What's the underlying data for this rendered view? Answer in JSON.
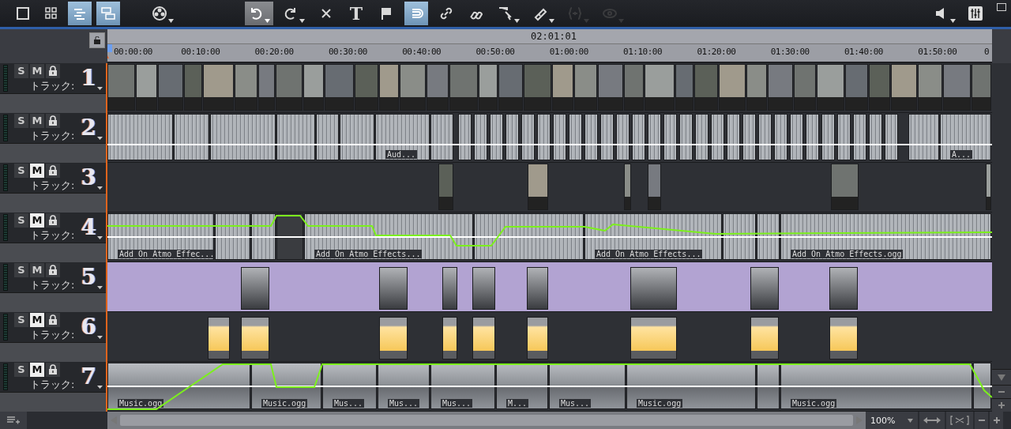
{
  "toolbar": {
    "groups": [
      [
        {
          "kind": "single-view",
          "selected": false,
          "disabled": false
        },
        {
          "kind": "grid-view",
          "selected": false,
          "disabled": false
        },
        {
          "kind": "timeline-view",
          "selected": true,
          "disabled": false
        },
        {
          "kind": "clip-view",
          "selected": true,
          "disabled": false
        }
      ],
      [
        {
          "kind": "reel",
          "selected": false,
          "disabled": false,
          "dropdown": true
        }
      ],
      [
        {
          "kind": "undo",
          "selected": true,
          "disabled": false,
          "dropdown": true
        },
        {
          "kind": "redo",
          "selected": false,
          "disabled": false,
          "dropdown": true
        },
        {
          "kind": "delete",
          "selected": false,
          "disabled": false
        },
        {
          "kind": "text",
          "text": "T",
          "selected": false,
          "disabled": false
        },
        {
          "kind": "flag",
          "selected": false,
          "disabled": false
        },
        {
          "kind": "magnet",
          "selected": true,
          "disabled": false
        },
        {
          "kind": "link",
          "selected": false,
          "disabled": false
        },
        {
          "kind": "unlink",
          "selected": false,
          "disabled": false
        },
        {
          "kind": "pointer",
          "selected": false,
          "disabled": false,
          "dropdown": true
        },
        {
          "kind": "razor",
          "selected": false,
          "disabled": false,
          "dropdown": true
        },
        {
          "kind": "effect",
          "selected": false,
          "disabled": true,
          "dropdown": true
        },
        {
          "kind": "eye",
          "selected": false,
          "disabled": true,
          "dropdown": true
        }
      ]
    ],
    "right": [
      {
        "kind": "speaker",
        "selected": false,
        "disabled": false,
        "dropdown": true
      },
      {
        "kind": "mixer",
        "selected": false,
        "disabled": false
      }
    ]
  },
  "ruler": {
    "duration": "02:01:01",
    "ticks": [
      "00:00:00",
      "00:10:00",
      "00:20:00",
      "00:30:00",
      "00:40:00",
      "00:50:00",
      "01:00:00",
      "01:10:00",
      "01:20:00",
      "01:30:00",
      "01:40:00",
      "01:50:00",
      "0"
    ]
  },
  "tracks": [
    {
      "number": "1",
      "label": "トラック:",
      "kind": "video",
      "solo": {
        "text": "S",
        "on": false
      },
      "mute": {
        "text": "M",
        "on": false
      }
    },
    {
      "number": "2",
      "label": "トラック:",
      "kind": "audio",
      "solo": {
        "text": "S",
        "on": false
      },
      "mute": {
        "text": "M",
        "on": false
      },
      "clips": [
        "Aud...",
        "A..."
      ]
    },
    {
      "number": "3",
      "label": "トラック:",
      "kind": "video",
      "solo": {
        "text": "S",
        "on": false
      },
      "mute": {
        "text": "M",
        "on": true
      }
    },
    {
      "number": "4",
      "label": "トラック:",
      "kind": "audio",
      "solo": {
        "text": "S",
        "on": false
      },
      "mute": {
        "text": "M",
        "on": true
      },
      "clips": [
        "Add On Atmo Effec...",
        "Add On Atmo Effects...",
        "Add On Atmo Effects...",
        "Add On Atmo Effects.ogg"
      ]
    },
    {
      "number": "5",
      "label": "トラック:",
      "kind": "title",
      "solo": {
        "text": "S",
        "on": false
      },
      "mute": {
        "text": "M",
        "on": false
      }
    },
    {
      "number": "6",
      "label": "トラック:",
      "kind": "image",
      "solo": {
        "text": "S",
        "on": false
      },
      "mute": {
        "text": "M",
        "on": true
      }
    },
    {
      "number": "7",
      "label": "トラック:",
      "kind": "music",
      "solo": {
        "text": "S",
        "on": false
      },
      "mute": {
        "text": "M",
        "on": true
      },
      "clips": [
        "Music.ogg",
        "Music.ogg",
        "Mus...",
        "Mus...",
        "Mus...",
        "M...",
        "Mus...",
        "Music.ogg",
        "Music.ogg"
      ]
    }
  ],
  "footer": {
    "zoom": "100%"
  }
}
